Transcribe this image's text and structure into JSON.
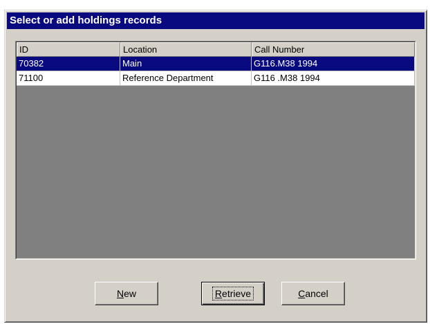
{
  "dialog": {
    "title": "Select or add holdings records"
  },
  "table": {
    "columns": [
      "ID",
      "Location",
      "Call Number"
    ],
    "rows": [
      {
        "id": "70382",
        "location": "Main",
        "call_number": "G116.M38 1994",
        "selected": true
      },
      {
        "id": "71100",
        "location": "Reference Department",
        "call_number": "G116 .M38 1994",
        "selected": false
      }
    ]
  },
  "buttons": {
    "new": {
      "mnemonic": "N",
      "rest": "ew"
    },
    "retrieve": {
      "mnemonic": "R",
      "rest": "etrieve"
    },
    "cancel": {
      "mnemonic": "C",
      "rest": "ancel"
    }
  },
  "colors": {
    "titlebar": "#0a0a80",
    "selection": "#0a0a80",
    "face": "#d4d0c8",
    "list_empty": "#808080"
  }
}
